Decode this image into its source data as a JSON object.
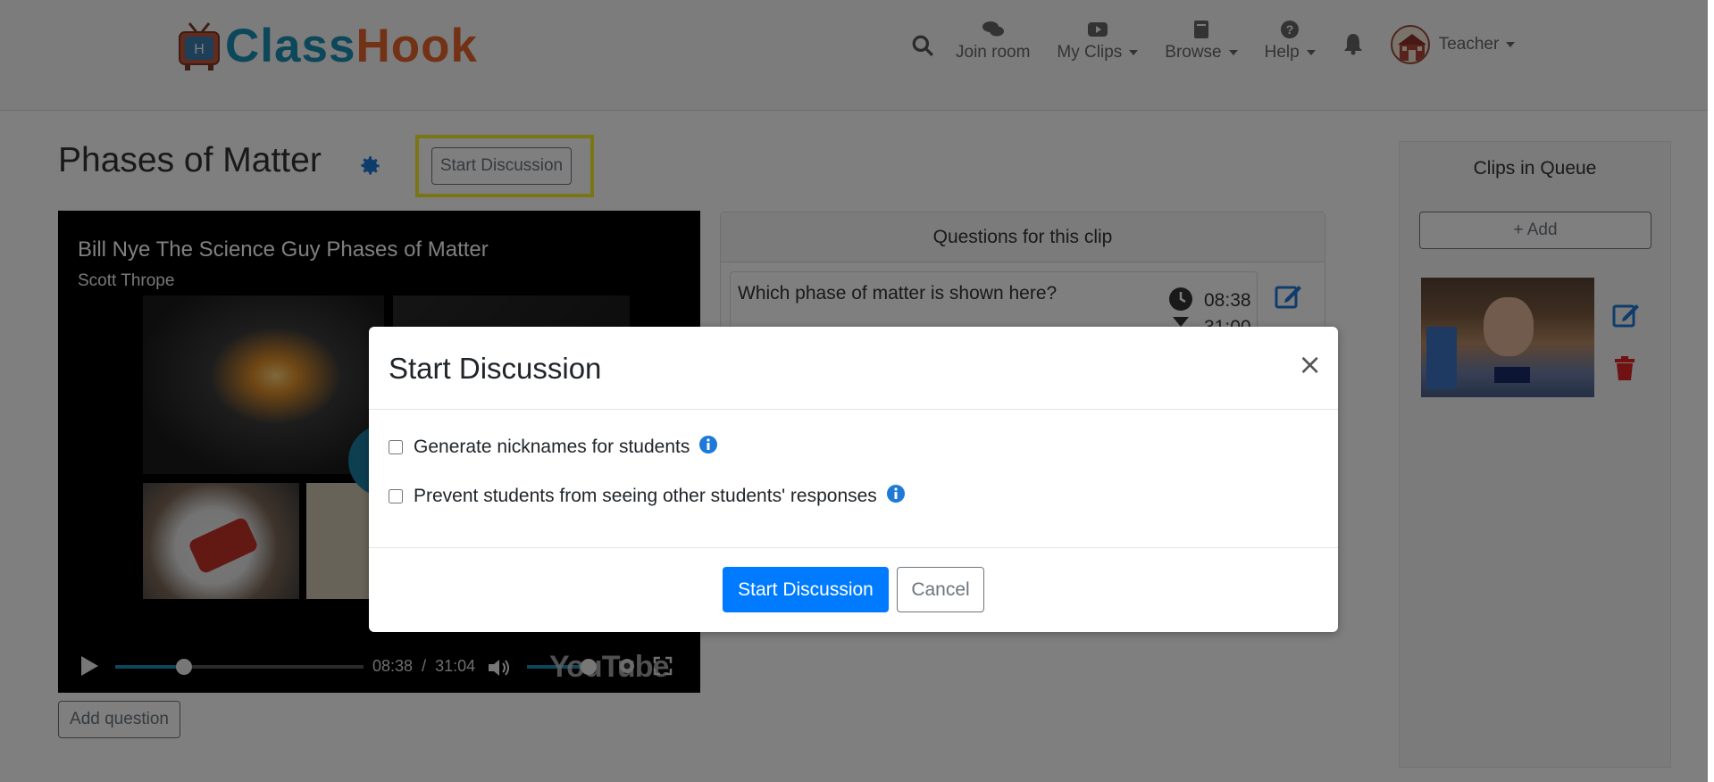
{
  "brand": {
    "name_part1": "Class",
    "name_part2": "Hook",
    "colors": {
      "blue": "#1a8fb5",
      "orange": "#e7622a"
    }
  },
  "nav": {
    "search_icon": "search-icon",
    "join_room": "Join room",
    "my_clips": "My Clips",
    "browse": "Browse",
    "help": "Help",
    "user": "Teacher"
  },
  "page": {
    "title": "Phases of Matter",
    "start_discussion_button": "Start Discussion",
    "add_question_button": "Add question"
  },
  "video": {
    "title": "Bill Nye The Science Guy Phases of Matter",
    "author": "Scott Thrope",
    "current_time": "08:38",
    "time_separator": "/",
    "duration": "31:04",
    "progress_fraction": 0.278,
    "volume_fraction": 0.78,
    "platform_logo": "YouTube"
  },
  "questions": {
    "header": "Questions for this clip",
    "items": [
      {
        "text": "Which phase of matter is shown here?",
        "time": "08:38",
        "end_time": "31:00"
      }
    ]
  },
  "queue": {
    "title": "Clips in Queue",
    "add_button": "+ Add"
  },
  "modal": {
    "title": "Start Discussion",
    "close_symbol": "×",
    "options": [
      {
        "label": "Generate nicknames for students",
        "checked": false
      },
      {
        "label": "Prevent students from seeing other students' responses",
        "checked": false
      }
    ],
    "primary_button": "Start Discussion",
    "cancel_button": "Cancel"
  },
  "colors": {
    "primary": "#007bff",
    "highlight": "#f5ea2a",
    "danger": "#e02424",
    "icon_blue": "#1e7ad6"
  }
}
